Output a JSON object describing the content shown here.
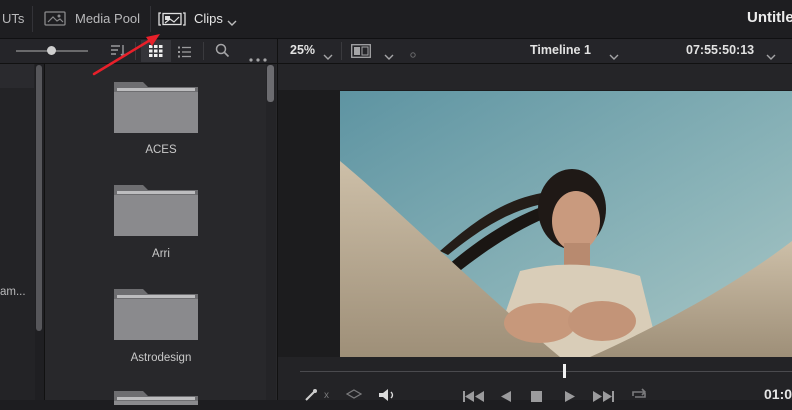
{
  "topbar": {
    "luts_label": "UTs",
    "media_pool_label": "Media Pool",
    "clips_label": "Clips",
    "project_title": "Untitle"
  },
  "toolbar": {
    "zoom_value": "25%",
    "timeline_name": "Timeline 1",
    "timecode": "07:55:50:13"
  },
  "sidebar": {
    "truncated_item": "am..."
  },
  "media_pool": {
    "folders": [
      {
        "name": "ACES"
      },
      {
        "name": "Arri"
      },
      {
        "name": "Astrodesign"
      },
      {
        "name": ""
      }
    ]
  },
  "transport": {
    "timecode_partial": "01:0"
  },
  "colors": {
    "annotation_arrow": "#e8202a",
    "background": "#1d1d20",
    "folder": "#8a8a8d"
  }
}
